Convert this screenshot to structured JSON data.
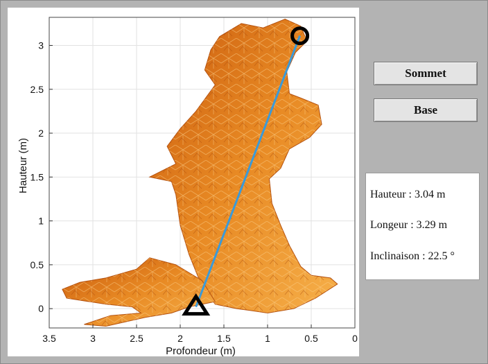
{
  "plot": {
    "xlabel": "Profondeur (m)",
    "ylabel": "Hauteur (m)",
    "x_ticks": [
      "3.5",
      "3",
      "2.5",
      "2",
      "1.5",
      "1",
      "0.5",
      "0"
    ],
    "y_ticks": [
      "0",
      "0.5",
      "1",
      "1.5",
      "2",
      "2.5",
      "3"
    ],
    "x_range": [
      3.5,
      0
    ],
    "y_range": [
      -0.22,
      3.32
    ],
    "line_color": "#3a9ad9",
    "surface_colors": [
      "#c95a0d",
      "#e88a24",
      "#f6b04a"
    ],
    "summit_point": {
      "x": 0.63,
      "y": 3.11,
      "marker": "circle-icon"
    },
    "base_point": {
      "x": 1.82,
      "y": 0.02,
      "marker": "triangle-icon"
    }
  },
  "buttons": {
    "sommet": "Sommet",
    "base": "Base"
  },
  "info": {
    "height": "Hauteur : 3.04 m",
    "length": "Longeur :  3.29 m",
    "inclination": "Inclinaison : 22.5 °"
  }
}
